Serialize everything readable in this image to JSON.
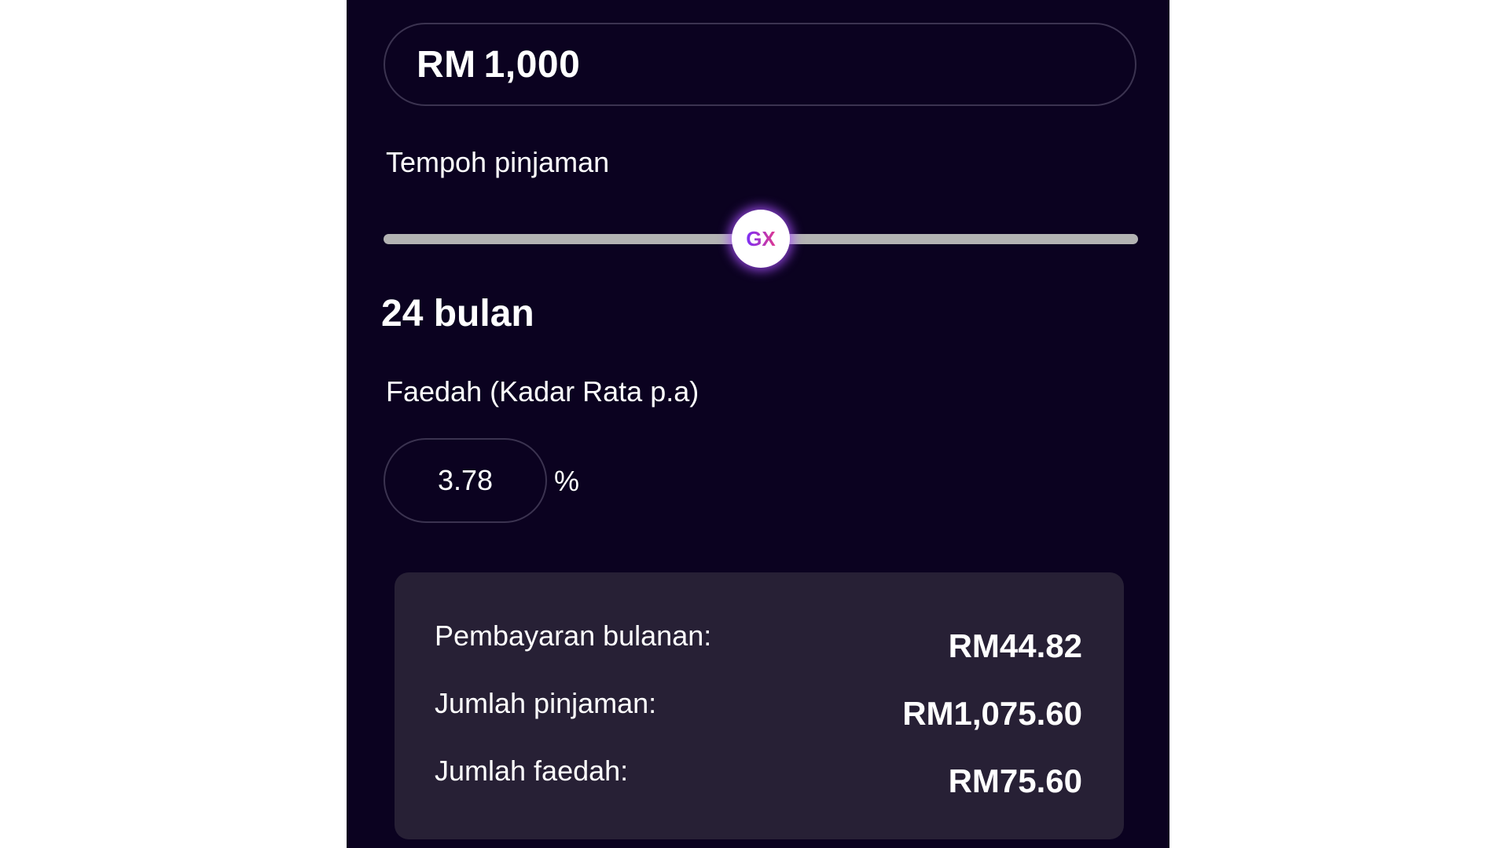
{
  "loan_amount": {
    "currency": "RM",
    "value": "1,000"
  },
  "tenure": {
    "label": "Tempoh pinjaman",
    "value_text": "24 bulan",
    "slider_fraction": 0.5,
    "thumb_logo": "GX"
  },
  "interest": {
    "label": "Faedah (Kadar Rata p.a)",
    "rate": "3.78",
    "unit": "%"
  },
  "results": [
    {
      "label": "Pembayaran bulanan:",
      "value": "RM44.82"
    },
    {
      "label": "Jumlah pinjaman:",
      "value": "RM1,075.60"
    },
    {
      "label": "Jumlah faedah:",
      "value": "RM75.60"
    }
  ],
  "colors": {
    "panel_background": "#0b0220",
    "results_background": "#272035",
    "track": "#b3b3b3",
    "thumb_glow": "#aa50ff",
    "logo_gradient_start": "#7b2ff7",
    "logo_gradient_end": "#e0398f"
  }
}
